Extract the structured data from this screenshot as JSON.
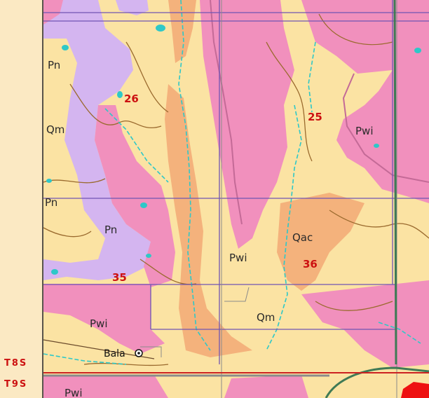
{
  "colors": {
    "margin": "#fbe9c3",
    "qm": "#fbe3a3",
    "pwi": "#f190bd",
    "pwi_dark": "#c46a97",
    "pn": "#d4b5f0",
    "qac": "#f4b27c",
    "contour": "#9a6a2e",
    "stream": "#2ec8c8",
    "section_line": "#7055b3",
    "section_number": "#cc1111",
    "township_line": "#cc2222",
    "road": "#8b8b8b",
    "highway": "#3f7a55"
  },
  "units": {
    "qm_top": "Qm",
    "qm_mid": "Qm",
    "pn_top": "Pn",
    "pn_mid": "Pn",
    "pn_low": "Pn",
    "pwi_right": "Pwi",
    "pwi_mid": "Pwi",
    "pwi_low": "Pwi",
    "pwi_bottom": "Pwi",
    "qac": "Qac"
  },
  "sections": {
    "s26": "26",
    "s25": "25",
    "s35": "35",
    "s36": "36"
  },
  "townships": {
    "upper": "T8S",
    "lower": "T9S"
  },
  "town": {
    "name": "Bala",
    "icon": "town-circle-icon"
  }
}
